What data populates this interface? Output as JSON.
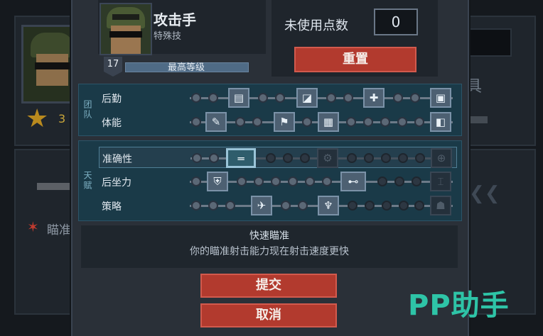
{
  "character": {
    "name": "攻击手",
    "class": "特殊技",
    "level": "17",
    "level_status": "最高等级"
  },
  "points": {
    "label": "未使用点数",
    "value": "0"
  },
  "reset_label": "重置",
  "groups": [
    {
      "label": "团队",
      "rows": [
        {
          "label": "后勤"
        },
        {
          "label": "体能"
        }
      ]
    },
    {
      "label": "天赋",
      "rows": [
        {
          "label": "准确性"
        },
        {
          "label": "后坐力"
        },
        {
          "label": "策略"
        }
      ]
    }
  ],
  "description": {
    "title": "快速瞄准",
    "text": "你的瞄准射击能力现在射击速度更快"
  },
  "buttons": {
    "submit": "提交",
    "cancel": "取消"
  },
  "background": {
    "stars": "3",
    "right_text": "具",
    "left_text": "瞄准"
  },
  "watermark": "PP助手",
  "icons": {
    "logistics": [
      "ammo-icon",
      "bandage-icon",
      "medkit-icon",
      "supply-icon"
    ],
    "stamina": [
      "syringe-icon",
      "boot-icon",
      "armor-icon",
      "pack-icon"
    ],
    "accuracy": [
      "rifle-scope-icon",
      "gears-icon",
      "crosshair-icon"
    ],
    "recoil": [
      "grip-icon",
      "scope-icon",
      "stand-icon"
    ],
    "tactics": [
      "grenade-icon",
      "claw-icon",
      "helmet-icon"
    ]
  },
  "colors": {
    "accent_red": "#b23a2e",
    "panel": "#2a3038",
    "tree_bg": "#1a3a48",
    "watermark": "#2ec4a7"
  }
}
